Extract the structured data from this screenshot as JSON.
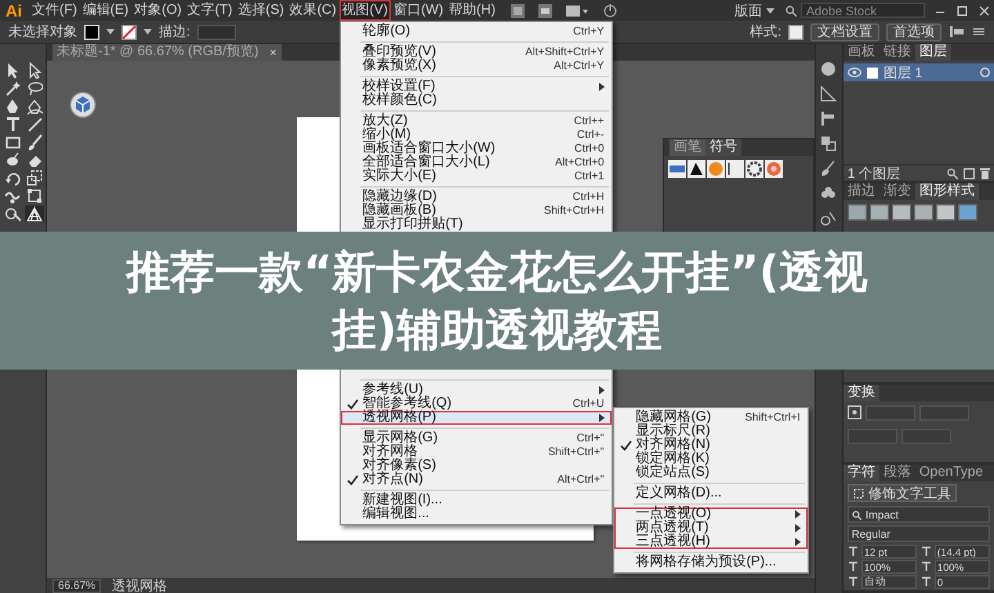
{
  "menubar": {
    "logo": "Ai",
    "items": [
      {
        "label": "文件(F)",
        "selected": false
      },
      {
        "label": "编辑(E)",
        "selected": false
      },
      {
        "label": "对象(O)",
        "selected": false
      },
      {
        "label": "文字(T)",
        "selected": false
      },
      {
        "label": "选择(S)",
        "selected": false
      },
      {
        "label": "效果(C)",
        "selected": false
      },
      {
        "label": "视图(V)",
        "selected": true
      },
      {
        "label": "窗口(W)",
        "selected": false
      },
      {
        "label": "帮助(H)",
        "selected": false
      }
    ],
    "workspace": "版面",
    "search": {
      "placeholder": "Adobe Stock"
    }
  },
  "control_bar": {
    "selection": "未选择对象",
    "stroke_label": "描边:",
    "style_label": "样式:",
    "buttons": [
      "文档设置",
      "首选项"
    ]
  },
  "document": {
    "tab": "未标题-1* @ 66.67% (RGB/预览)",
    "close": "×",
    "zoom": "66.67%",
    "status": "透视网格"
  },
  "symbols_panel": {
    "tabs": [
      {
        "label": "画笔",
        "selected": false
      },
      {
        "label": "符号",
        "selected": true
      }
    ]
  },
  "layers_panel": {
    "tabs": [
      {
        "label": "画板",
        "selected": false
      },
      {
        "label": "链接",
        "selected": false
      },
      {
        "label": "图层",
        "selected": true
      }
    ],
    "layers": [
      {
        "name": "图层 1",
        "visible": true,
        "selected": true
      }
    ],
    "footer": "1 个图层"
  },
  "styles_panel": {
    "tabs": [
      {
        "label": "描边",
        "selected": false
      },
      {
        "label": "渐变",
        "selected": false
      },
      {
        "label": "图形样式",
        "selected": true
      }
    ]
  },
  "transform_panel": {
    "tabs": [
      {
        "label": "变换",
        "selected": true
      }
    ]
  },
  "character_panel": {
    "tabs": [
      {
        "label": "字符",
        "selected": true
      },
      {
        "label": "段落",
        "selected": false
      },
      {
        "label": "OpenType",
        "selected": false
      }
    ],
    "touch_button": "修饰文字工具",
    "font": "Impact",
    "style": "Regular",
    "fields": [
      "12 pt",
      "(14.4 pt)",
      "100%",
      "100%",
      "自动",
      "0"
    ]
  },
  "view_menu": {
    "items": [
      {
        "kind": "item",
        "label": "轮廓(O)",
        "shortcut": "Ctrl+Y",
        "checked": false,
        "has_submenu": false,
        "selected": false,
        "outlined": false
      },
      {
        "kind": "separator"
      },
      {
        "kind": "item",
        "label": "叠印预览(V)",
        "shortcut": "Alt+Shift+Ctrl+Y",
        "checked": false,
        "has_submenu": false,
        "selected": false,
        "outlined": false
      },
      {
        "kind": "item",
        "label": "像素预览(X)",
        "shortcut": "Alt+Ctrl+Y",
        "checked": false,
        "has_submenu": false,
        "selected": false,
        "outlined": false
      },
      {
        "kind": "separator"
      },
      {
        "kind": "item",
        "label": "校样设置(F)",
        "checked": false,
        "has_submenu": true,
        "selected": false,
        "outlined": false
      },
      {
        "kind": "item",
        "label": "校样颜色(C)",
        "checked": false,
        "has_submenu": false,
        "selected": false,
        "outlined": false
      },
      {
        "kind": "separator"
      },
      {
        "kind": "item",
        "label": "放大(Z)",
        "shortcut": "Ctrl++",
        "checked": false,
        "has_submenu": false,
        "selected": false,
        "outlined": false
      },
      {
        "kind": "item",
        "label": "缩小(M)",
        "shortcut": "Ctrl+-",
        "checked": false,
        "has_submenu": false,
        "selected": false,
        "outlined": false
      },
      {
        "kind": "item",
        "label": "画板适合窗口大小(W)",
        "shortcut": "Ctrl+0",
        "checked": false,
        "has_submenu": false,
        "selected": false,
        "outlined": false
      },
      {
        "kind": "item",
        "label": "全部适合窗口大小(L)",
        "shortcut": "Alt+Ctrl+0",
        "checked": false,
        "has_submenu": false,
        "selected": false,
        "outlined": false
      },
      {
        "kind": "item",
        "label": "实际大小(E)",
        "shortcut": "Ctrl+1",
        "checked": false,
        "has_submenu": false,
        "selected": false,
        "outlined": false
      },
      {
        "kind": "separator"
      },
      {
        "kind": "item",
        "label": "隐藏边缘(D)",
        "shortcut": "Ctrl+H",
        "checked": false,
        "has_submenu": false,
        "selected": false,
        "outlined": false
      },
      {
        "kind": "item",
        "label": "隐藏画板(B)",
        "shortcut": "Shift+Ctrl+H",
        "checked": false,
        "has_submenu": false,
        "selected": false,
        "outlined": false
      },
      {
        "kind": "item",
        "label": "显示打印拼贴(T)",
        "checked": false,
        "has_submenu": false,
        "selected": false,
        "outlined": false
      },
      {
        "kind": "separator"
      },
      {
        "kind": "covered"
      },
      {
        "kind": "separator"
      },
      {
        "kind": "item",
        "label": "参考线(U)",
        "checked": false,
        "has_submenu": true,
        "selected": false,
        "outlined": false
      },
      {
        "kind": "item",
        "label": "智能参考线(Q)",
        "shortcut": "Ctrl+U",
        "checked": true,
        "has_submenu": false,
        "selected": false,
        "outlined": false
      },
      {
        "kind": "item",
        "label": "透视网格(P)",
        "checked": false,
        "has_submenu": true,
        "selected": true,
        "outlined": true
      },
      {
        "kind": "separator"
      },
      {
        "kind": "item",
        "label": "显示网格(G)",
        "shortcut": "Ctrl+\"",
        "checked": false,
        "has_submenu": false,
        "selected": false,
        "outlined": false
      },
      {
        "kind": "item",
        "label": "对齐网格",
        "shortcut": "Shift+Ctrl+\"",
        "checked": false,
        "has_submenu": false,
        "selected": false,
        "outlined": false
      },
      {
        "kind": "item",
        "label": "对齐像素(S)",
        "checked": false,
        "has_submenu": false,
        "selected": false,
        "outlined": false
      },
      {
        "kind": "item",
        "label": "对齐点(N)",
        "shortcut": "Alt+Ctrl+\"",
        "checked": true,
        "has_submenu": false,
        "selected": false,
        "outlined": false
      },
      {
        "kind": "separator"
      },
      {
        "kind": "item",
        "label": "新建视图(I)...",
        "checked": false,
        "has_submenu": false,
        "selected": false,
        "outlined": false
      },
      {
        "kind": "item",
        "label": "编辑视图...",
        "checked": false,
        "has_submenu": false,
        "selected": false,
        "outlined": false
      }
    ]
  },
  "perspective_submenu": {
    "items": [
      {
        "kind": "item",
        "label": "隐藏网格(G)",
        "shortcut": "Shift+Ctrl+I",
        "checked": false,
        "has_submenu": false,
        "selected": false,
        "outlined": false
      },
      {
        "kind": "item",
        "label": "显示标尺(R)",
        "checked": false,
        "has_submenu": false,
        "selected": false,
        "outlined": false
      },
      {
        "kind": "item",
        "label": "对齐网格(N)",
        "checked": true,
        "has_submenu": false,
        "selected": false,
        "outlined": false
      },
      {
        "kind": "item",
        "label": "锁定网格(K)",
        "checked": false,
        "has_submenu": false,
        "selected": false,
        "outlined": false
      },
      {
        "kind": "item",
        "label": "锁定站点(S)",
        "checked": false,
        "has_submenu": false,
        "selected": false,
        "outlined": false
      },
      {
        "kind": "separator"
      },
      {
        "kind": "item",
        "label": "定义网格(D)...",
        "checked": false,
        "has_submenu": false,
        "selected": false,
        "outlined": false
      },
      {
        "kind": "separator"
      },
      {
        "kind": "item",
        "label": "一点透视(O)",
        "checked": false,
        "has_submenu": true,
        "selected": false,
        "outlined": true
      },
      {
        "kind": "item",
        "label": "两点透视(T)",
        "checked": false,
        "has_submenu": true,
        "selected": false,
        "outlined": true
      },
      {
        "kind": "item",
        "label": "三点透视(H)",
        "checked": false,
        "has_submenu": true,
        "selected": false,
        "outlined": true
      },
      {
        "kind": "separator"
      },
      {
        "kind": "item",
        "label": "将网格存储为预设(P)...",
        "checked": false,
        "has_submenu": false,
        "selected": false,
        "outlined": false
      }
    ]
  },
  "banner": {
    "title": "推荐一款“新卡农金花怎么开挂”(透视挂)辅助透视教程"
  }
}
